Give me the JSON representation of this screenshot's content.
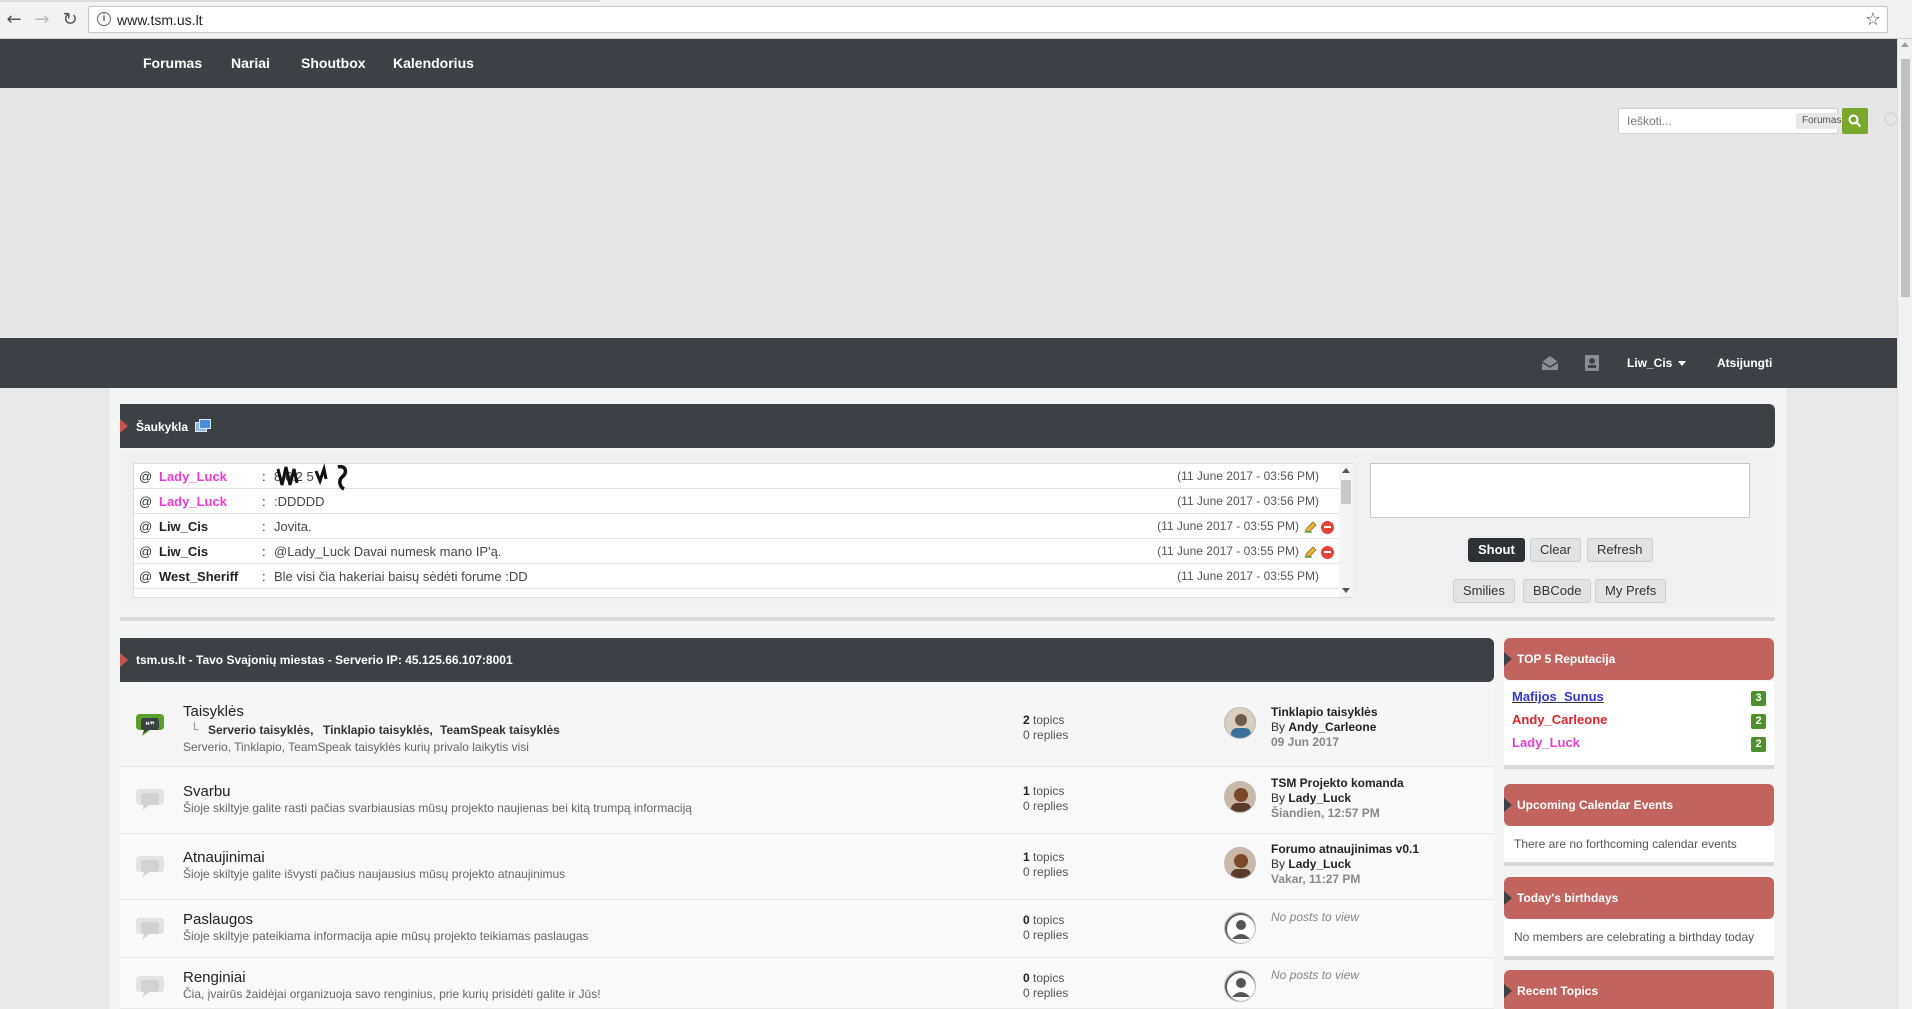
{
  "browser": {
    "url": "www.tsm.us.lt",
    "back_label": "←",
    "forward_label": "→",
    "reload_label": "↻",
    "info_label": "i",
    "star_label": "☆"
  },
  "nav": {
    "items": [
      "Forumas",
      "Nariai",
      "Shoutbox",
      "Kalendorius"
    ]
  },
  "search": {
    "placeholder": "Ieškoti...",
    "scope": "Forumas"
  },
  "userbar": {
    "username": "Liw_Cis",
    "logout": "Atsijungti"
  },
  "shoutbox": {
    "title": "Šaukykla",
    "at_label": "@",
    "colon": ":",
    "rows": [
      {
        "name": "Lady_Luck",
        "color": "#e43fcf",
        "message": "8   6.2  5",
        "time": "(11 June 2017 - 03:56 PM)",
        "own": false
      },
      {
        "name": "Lady_Luck",
        "color": "#e43fcf",
        "message": ":DDDDD",
        "time": "(11 June 2017 - 03:56 PM)",
        "own": false
      },
      {
        "name": "Liw_Cis",
        "color": "#222222",
        "message": "Jovita.",
        "time": "(11 June 2017 - 03:55 PM)",
        "own": true
      },
      {
        "name": "Liw_Cis",
        "color": "#222222",
        "message": "@Lady_Luck Davai numesk mano IP'ą.",
        "time": "(11 June 2017 - 03:55 PM)",
        "own": true
      },
      {
        "name": "West_Sheriff",
        "color": "#222222",
        "message": "Ble visi čia hakeriai baisų sėdėti forume :DD",
        "time": "(11 June 2017 - 03:55 PM)",
        "own": false
      }
    ],
    "buttons": {
      "shout": "Shout",
      "clear": "Clear",
      "refresh": "Refresh",
      "smilies": "Smilies",
      "bbcode": "BBCode",
      "prefs": "My Prefs"
    }
  },
  "forum": {
    "title": "tsm.us.lt - Tavo Svajonių miestas - Serverio IP: 45.125.66.107:8001",
    "rows": [
      {
        "title": "Taisyklės",
        "subforums": [
          "Serverio taisyklės,",
          "Tinklapio taisyklės,",
          "TeamSpeak taisyklės"
        ],
        "desc": "Serverio, Tinklapio, TeamSpeak taisyklės kurių privalo laikytis visi",
        "topics": "2",
        "replies": "0",
        "last_title": "Tinklapio taisyklės",
        "last_by": "Andy_Carleone",
        "last_date": "09 Jun 2017",
        "active": true
      },
      {
        "title": "Svarbu",
        "desc": "Šioje skiltyje galite rasti pačias svarbiausias mūsų projekto naujienas bei kitą trumpą informaciją",
        "topics": "1",
        "replies": "0",
        "last_title": "TSM Projekto komanda",
        "last_by": "Lady_Luck",
        "last_date": "Šiandien, 12:57 PM"
      },
      {
        "title": "Atnaujinimai",
        "desc": "Šioje skiltyje galite išvysti pačius naujausius mūsų projekto atnaujinimus",
        "topics": "1",
        "replies": "0",
        "last_title": "Forumo atnaujinimas v0.1",
        "last_by": "Lady_Luck",
        "last_date": "Vakar, 11:27 PM"
      },
      {
        "title": "Paslaugos",
        "desc": "Šioje skiltyje pateikiama informacija apie mūsų projekto teikiamas paslaugas",
        "topics": "0",
        "replies": "0",
        "none": "No posts to view"
      },
      {
        "title": "Renginiai",
        "desc": "Čia, įvairūs žaidėjai organizuoja savo renginius, prie kurių prisidėti galite ir Jūs!",
        "topics": "0",
        "replies": "0",
        "none": "No posts to view"
      }
    ],
    "topics_word": "topics",
    "replies_word": "replies",
    "by_word": "By"
  },
  "sidebar": {
    "reputation": {
      "title": "TOP 5 Reputacija",
      "users": [
        {
          "name": "Mafijos_Sunus",
          "count": "3",
          "color": "#3535c8"
        },
        {
          "name": "Andy_Carleone",
          "count": "2",
          "color": "#d8262a"
        },
        {
          "name": "Lady_Luck",
          "count": "2",
          "color": "#e43fcf"
        }
      ]
    },
    "calendar": {
      "title": "Upcoming Calendar Events",
      "text": "There are no forthcoming calendar events"
    },
    "birthdays": {
      "title": "Today's birthdays",
      "text": "No members are celebrating a birthday today"
    },
    "recent": {
      "title": "Recent Topics"
    }
  }
}
